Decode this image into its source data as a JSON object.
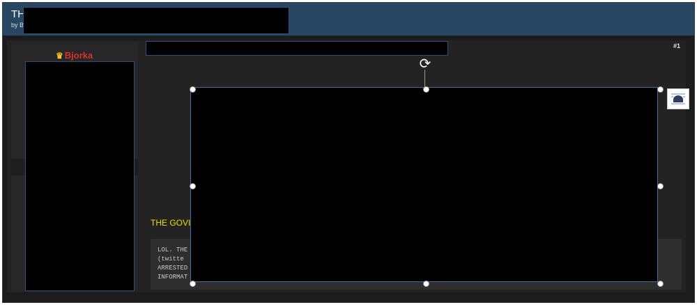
{
  "header": {
    "title": "TH",
    "byline": "by B"
  },
  "user": {
    "name": "Bjorka",
    "crown_icon": "crown-icon"
  },
  "post": {
    "number": "#1",
    "headline": "THE GOVI",
    "quote_lines": [
      "LOL. THE",
      "(twitte",
      "ARRESTED",
      "INFORMAT"
    ]
  },
  "editor": {
    "rotate_icon": "rotate-icon",
    "layout_options_icon": "layout-options-icon"
  },
  "colors": {
    "header_bg": "#284763",
    "page_bg": "#1c1c1c",
    "username": "#d8322c",
    "crown": "#f2c230",
    "headline": "#e8e000",
    "selection_border": "#4b6ea8"
  }
}
